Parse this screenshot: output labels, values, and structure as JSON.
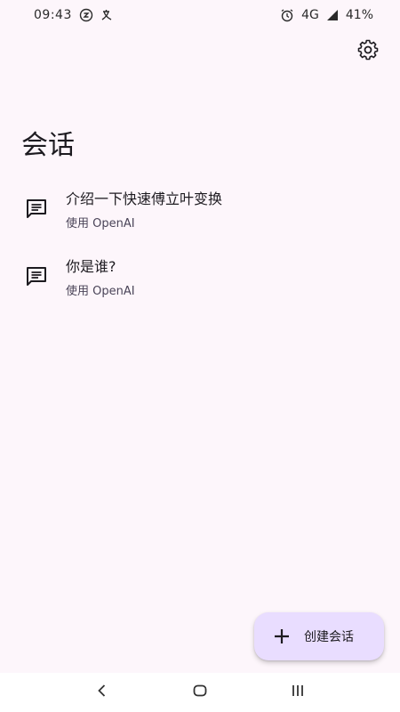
{
  "status_bar": {
    "time": "09:43",
    "network": "4G",
    "battery": "41%",
    "icons": [
      "notification-icon",
      "translate-icon",
      "alarm-icon",
      "signal-icon"
    ]
  },
  "header": {
    "settings_icon": "gear-icon"
  },
  "page": {
    "title": "会话"
  },
  "conversations": [
    {
      "title": "介绍一下快速傅立叶变换",
      "subtitle": "使用 OpenAI",
      "icon": "message-icon"
    },
    {
      "title": "你是谁?",
      "subtitle": "使用 OpenAI",
      "icon": "message-icon"
    }
  ],
  "fab": {
    "label": "创建会话",
    "icon": "plus-icon",
    "color": "#e9ddff"
  },
  "nav_bar": {
    "buttons": [
      "back-icon",
      "home-icon",
      "recents-icon"
    ]
  },
  "colors": {
    "background": "#fdf6fb",
    "text": "#1d1b20",
    "fab_background": "#e9ddff"
  }
}
